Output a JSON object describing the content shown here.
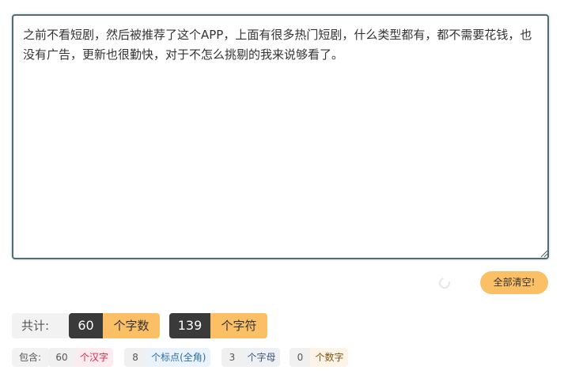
{
  "editor": {
    "text": "之前不看短剧，然后被推荐了这个APP，上面有很多热门短剧，什么类型都有，都不需要花钱，也没有广告，更新也很勤快，对于不怎么挑剔的我来说够看了。"
  },
  "actions": {
    "clear_label": "全部清空!"
  },
  "totals": {
    "label": "共计:",
    "char_count": "60",
    "char_unit": "个字数",
    "symbol_count": "139",
    "symbol_unit": "个字符"
  },
  "breakdown": {
    "label": "包含:",
    "hanzi_count": "60",
    "hanzi_label": "个汉字",
    "punct_count": "8",
    "punct_label": "个标点(全角)",
    "letter_count": "3",
    "letter_label": "个字母",
    "digit_count": "0",
    "digit_label": "个数字"
  },
  "colors": {
    "accent": "#fbbf66",
    "dark": "#3a3a3a",
    "editor_border": "#4f6d73"
  }
}
